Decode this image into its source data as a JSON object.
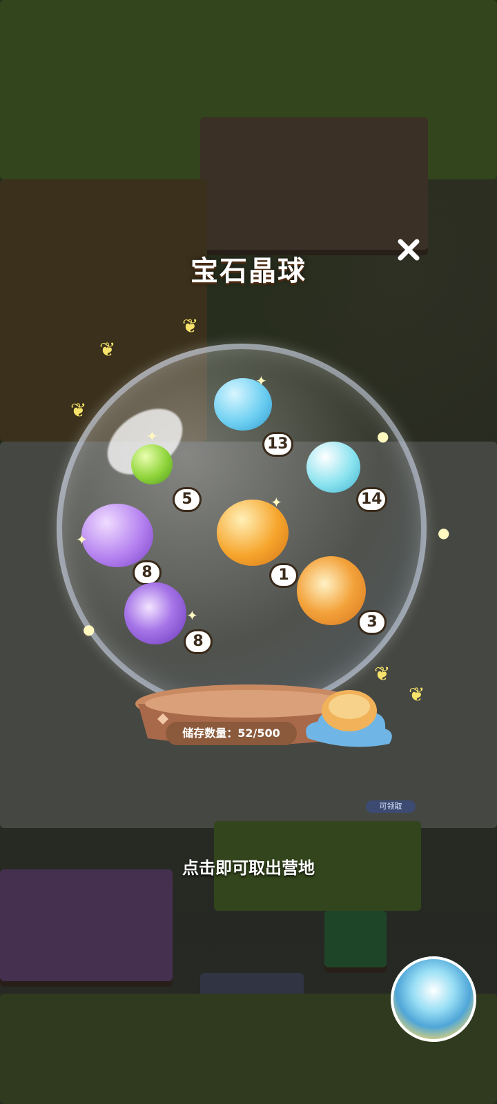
{
  "modal": {
    "title": "宝石晶球",
    "close_icon": "close-icon",
    "storage_label": "储存数量：52/500",
    "hint": "点击即可取出营地"
  },
  "gems": [
    {
      "name": "blue-bear-gem",
      "color": "#6fd0f2",
      "count": "13"
    },
    {
      "name": "green-leaf-gem",
      "color": "#8fd43a",
      "count": "5"
    },
    {
      "name": "cyan-crystal-gem",
      "color": "#8be3ef",
      "count": "14"
    },
    {
      "name": "purple-bear-gem",
      "color": "#b582f0",
      "count": "8"
    },
    {
      "name": "orange-bear-gem",
      "color": "#f6a52c",
      "count": "1"
    },
    {
      "name": "purple-rose-gem",
      "color": "#a675e8",
      "count": "8"
    },
    {
      "name": "orange-rose-gem",
      "color": "#f3a23a",
      "count": "3"
    }
  ],
  "background": {
    "claim_badge": "可领取"
  },
  "colors": {
    "title_shadow": "#4a2a10",
    "storage_bg": "#8b5a3c"
  }
}
